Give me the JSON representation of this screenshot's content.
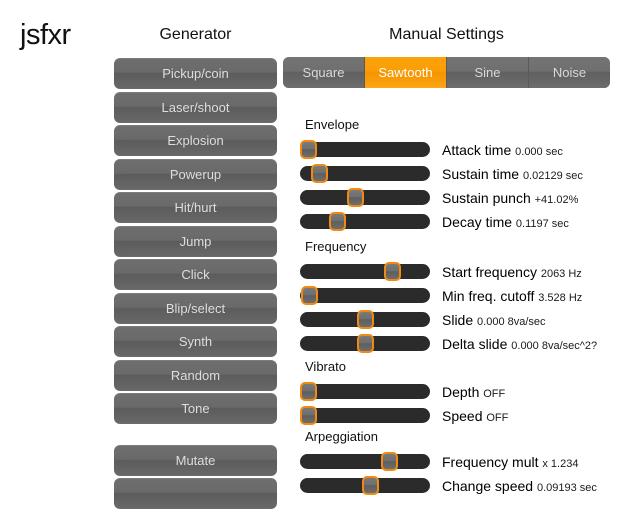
{
  "app": {
    "title": "jsfxr"
  },
  "generator": {
    "heading": "Generator",
    "buttons": [
      {
        "label": "Pickup/coin"
      },
      {
        "label": "Laser/shoot"
      },
      {
        "label": "Explosion"
      },
      {
        "label": "Powerup"
      },
      {
        "label": "Hit/hurt"
      },
      {
        "label": "Jump"
      },
      {
        "label": "Click"
      },
      {
        "label": "Blip/select"
      },
      {
        "label": "Synth"
      },
      {
        "label": "Random"
      },
      {
        "label": "Tone"
      }
    ],
    "actions": [
      {
        "label": "Mutate"
      },
      {
        "label": ""
      }
    ]
  },
  "manual": {
    "heading": "Manual Settings",
    "wave_tabs": [
      {
        "label": "Square",
        "active": false
      },
      {
        "label": "Sawtooth",
        "active": true
      },
      {
        "label": "Sine",
        "active": false
      },
      {
        "label": "Noise",
        "active": false
      }
    ],
    "groups": [
      {
        "title": "Envelope",
        "params": [
          {
            "label": "Attack time",
            "value": "0.000 sec",
            "position": 0
          },
          {
            "label": "Sustain time",
            "value": "0.02129 sec",
            "position": 10
          },
          {
            "label": "Sustain punch",
            "value": "+41.02%",
            "position": 41
          },
          {
            "label": "Decay time",
            "value": "0.1197 sec",
            "position": 25
          }
        ]
      },
      {
        "title": "Frequency",
        "params": [
          {
            "label": "Start frequency",
            "value": "2063 Hz",
            "position": 74
          },
          {
            "label": "Min freq. cutoff",
            "value": "3.528 Hz",
            "position": 1
          },
          {
            "label": "Slide",
            "value": "0.000 8va/sec",
            "position": 50
          },
          {
            "label": "Delta slide",
            "value": "0.000 8va/sec^2?",
            "position": 50
          }
        ]
      },
      {
        "title": "Vibrato",
        "params": [
          {
            "label": "Depth",
            "value": "OFF",
            "position": 0
          },
          {
            "label": "Speed",
            "value": "OFF",
            "position": 0
          }
        ]
      },
      {
        "title": "Arpeggiation",
        "params": [
          {
            "label": "Frequency mult",
            "value": "x 1.234",
            "position": 71
          },
          {
            "label": "Change speed",
            "value": "0.09193 sec",
            "position": 54
          }
        ]
      }
    ]
  },
  "colors": {
    "accent": "#f59400",
    "handle_border": "#f08a12",
    "track": "#2b2b2b",
    "button": "#6a6a6a",
    "page_background": "#ffffff"
  }
}
